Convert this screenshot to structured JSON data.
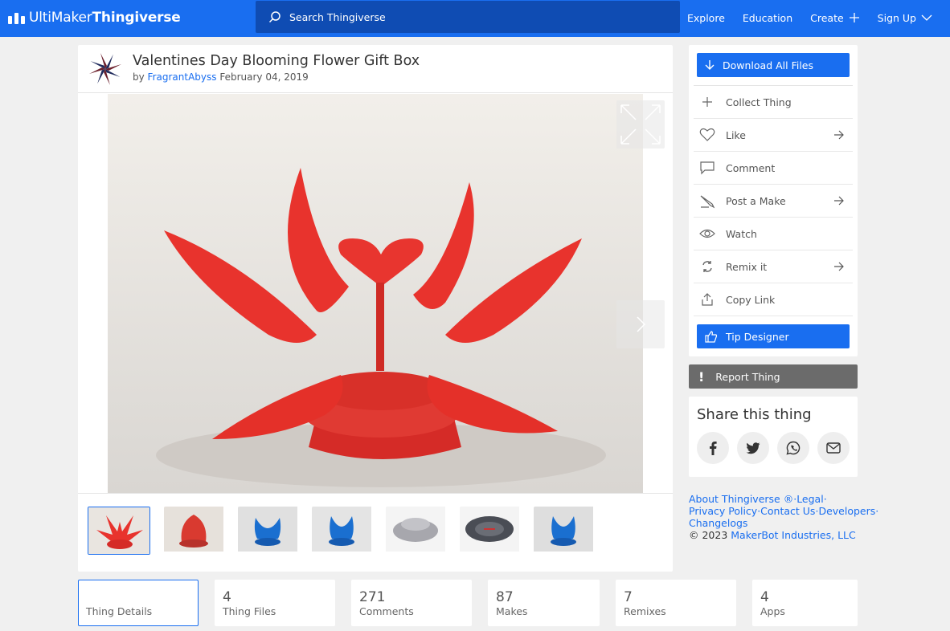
{
  "header": {
    "brand_light": "UltiMaker",
    "brand_bold": " Thingiverse",
    "search_placeholder": "Search Thingiverse",
    "nav": {
      "explore": "Explore",
      "education": "Education",
      "create": "Create",
      "signup": "Sign Up"
    }
  },
  "thing": {
    "title": "Valentines Day Blooming Flower Gift Box",
    "by": "by ",
    "author": "FragrantAbyss",
    "date": " February 04, 2019"
  },
  "actions": {
    "download": "Download All Files",
    "collect": "Collect Thing",
    "like": "Like",
    "comment": "Comment",
    "post_make": "Post a Make",
    "watch": "Watch",
    "remix": "Remix it",
    "copy_link": "Copy Link",
    "tip": "Tip Designer",
    "report": "Report Thing"
  },
  "share": {
    "title": "Share this thing"
  },
  "footer": {
    "about": "About Thingiverse ®",
    "legal": "Legal",
    "privacy": "Privacy Policy",
    "contact": "Contact Us",
    "developers": "Developers",
    "changelogs": "Changelogs",
    "copyright": "©  2023 ",
    "company": "MakerBot Industries, LLC"
  },
  "stats": [
    {
      "num": "",
      "label": "Thing Details"
    },
    {
      "num": "4",
      "label": "Thing Files"
    },
    {
      "num": "271",
      "label": "Comments"
    },
    {
      "num": "87",
      "label": "Makes"
    },
    {
      "num": "7",
      "label": "Remixes"
    },
    {
      "num": "4",
      "label": "Apps"
    }
  ],
  "colors": {
    "brand_blue": "#196ef0",
    "search_bg": "#0f4cb3",
    "report_gray": "#6b6b6b",
    "flower_red": "#e8332d"
  }
}
